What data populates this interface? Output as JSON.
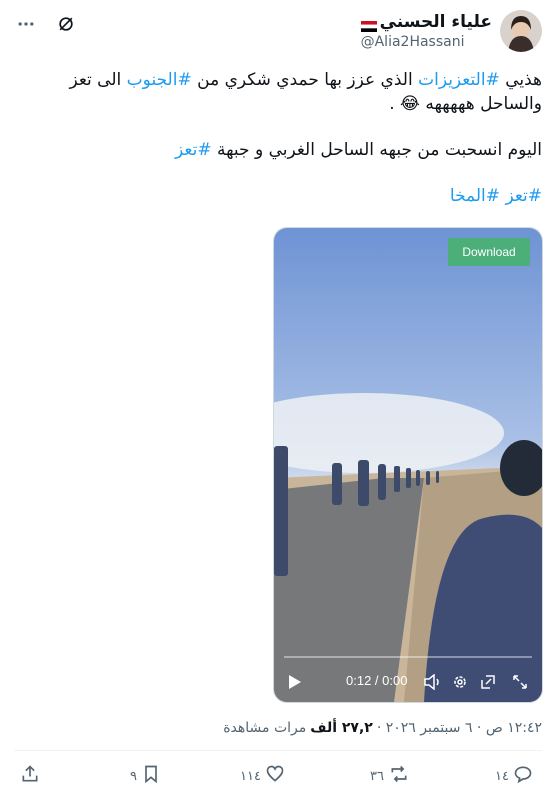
{
  "author": {
    "display_name": "علياء الحسني",
    "flag": "🇾🇪",
    "handle": "@Alia2Hassani"
  },
  "tweet": {
    "line1_pre": "هذيي ",
    "line1_tag1": "#التعزيزات",
    "line1_mid": " الذي عزز بها حمدي شكري من ",
    "line1_tag2": "#الجنوب",
    "line1_post": " الى تعز",
    "line2": "والساحل هههههه 😂 .",
    "line3_pre": "اليوم انسحبت من جبهه الساحل الغربي و جبهة ",
    "line3_tag": "#تعز",
    "line4_tag1": "#تعز",
    "line4_tag2": "#المخا"
  },
  "video": {
    "download_label": "Download",
    "time_label": "0:12 / 0:00",
    "progress": 0
  },
  "meta": {
    "timestamp": "١٢:٤٢ ص · ٦ سبتمبر ٢٠٢٦ ·",
    "views_count": "٢٧,٢ ألف",
    "views_label": "مرات مشاهدة"
  },
  "actions": {
    "replies": "١٤",
    "retweets": "٣٦",
    "likes": "١١٤",
    "bookmarks": "٩"
  },
  "colors": {
    "accent": "#1d9bf0",
    "secondary_text": "#536471",
    "download_bg": "#4caf7a"
  }
}
